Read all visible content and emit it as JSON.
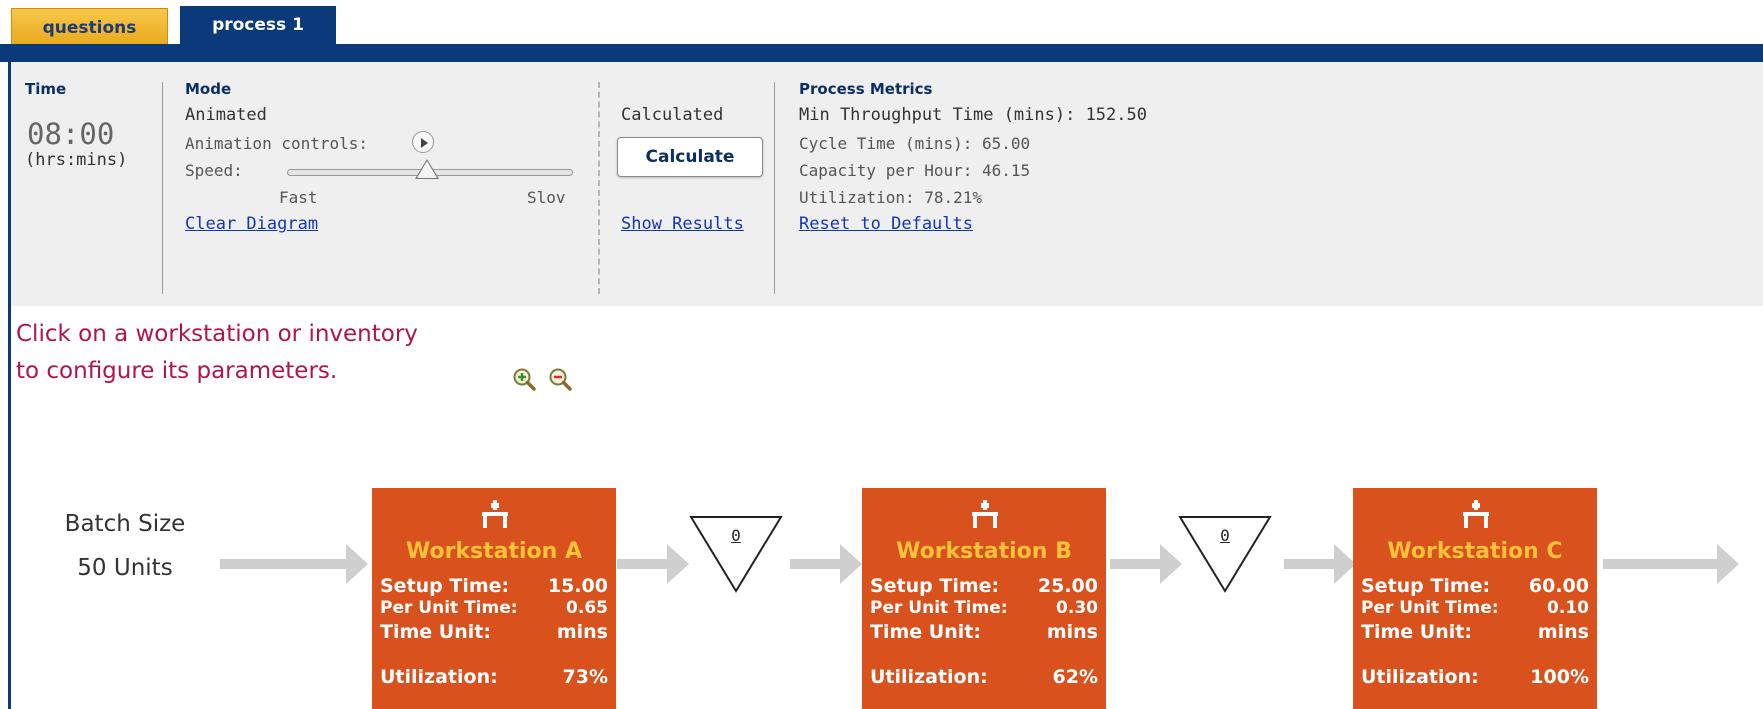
{
  "tabs": [
    {
      "label": "questions",
      "active": false
    },
    {
      "label": "process 1",
      "active": true
    }
  ],
  "time": {
    "heading": "Time",
    "value": "08:00",
    "unit": "(hrs:mins)"
  },
  "mode": {
    "heading": "Mode",
    "animated_label": "Animated",
    "animation_controls_label": "Animation controls:",
    "speed_label": "Speed:",
    "speed_fast": "Fast",
    "speed_slow": "Slov",
    "speed_level": 0.5,
    "clear_diagram": "Clear Diagram",
    "calculated_label": "Calculated",
    "calculate_button": "Calculate",
    "show_results": "Show Results"
  },
  "metrics": {
    "heading": "Process Metrics",
    "min_throughput": "Min Throughput Time (mins): 152.50",
    "cycle_time": "Cycle Time (mins): 65.00",
    "capacity": "Capacity per Hour: 46.15",
    "utilization": "Utilization: 78.21%",
    "reset": "Reset to Defaults"
  },
  "instructions": {
    "line1": "Click on a workstation or inventory",
    "line2": "to configure its parameters."
  },
  "zoom": {
    "zoom_in_icon": "zoom-in-icon",
    "zoom_out_icon": "zoom-out-icon"
  },
  "batch": {
    "label": "Batch Size",
    "value": "50 Units"
  },
  "workstation_labels": {
    "setup": "Setup Time:",
    "per_unit": "Per Unit Time:",
    "time_unit": "Time Unit:",
    "utilization": "Utilization:"
  },
  "workstations": [
    {
      "title": "Workstation A",
      "setup": "15.00",
      "per_unit": "0.65",
      "time_unit": "mins",
      "utilization": "73%"
    },
    {
      "title": "Workstation B",
      "setup": "25.00",
      "per_unit": "0.30",
      "time_unit": "mins",
      "utilization": "62%"
    },
    {
      "title": "Workstation C",
      "setup": "60.00",
      "per_unit": "0.10",
      "time_unit": "mins",
      "utilization": "100%"
    }
  ],
  "inventories": [
    {
      "count": "0"
    },
    {
      "count": "0"
    }
  ],
  "colors": {
    "workstation_bg": "#d9521e",
    "workstation_title": "#ffc23a",
    "tab_active": "#0b3a7a",
    "tab_inactive": "#f2b632",
    "instruction_text": "#b0154a",
    "link": "#1236b8"
  }
}
